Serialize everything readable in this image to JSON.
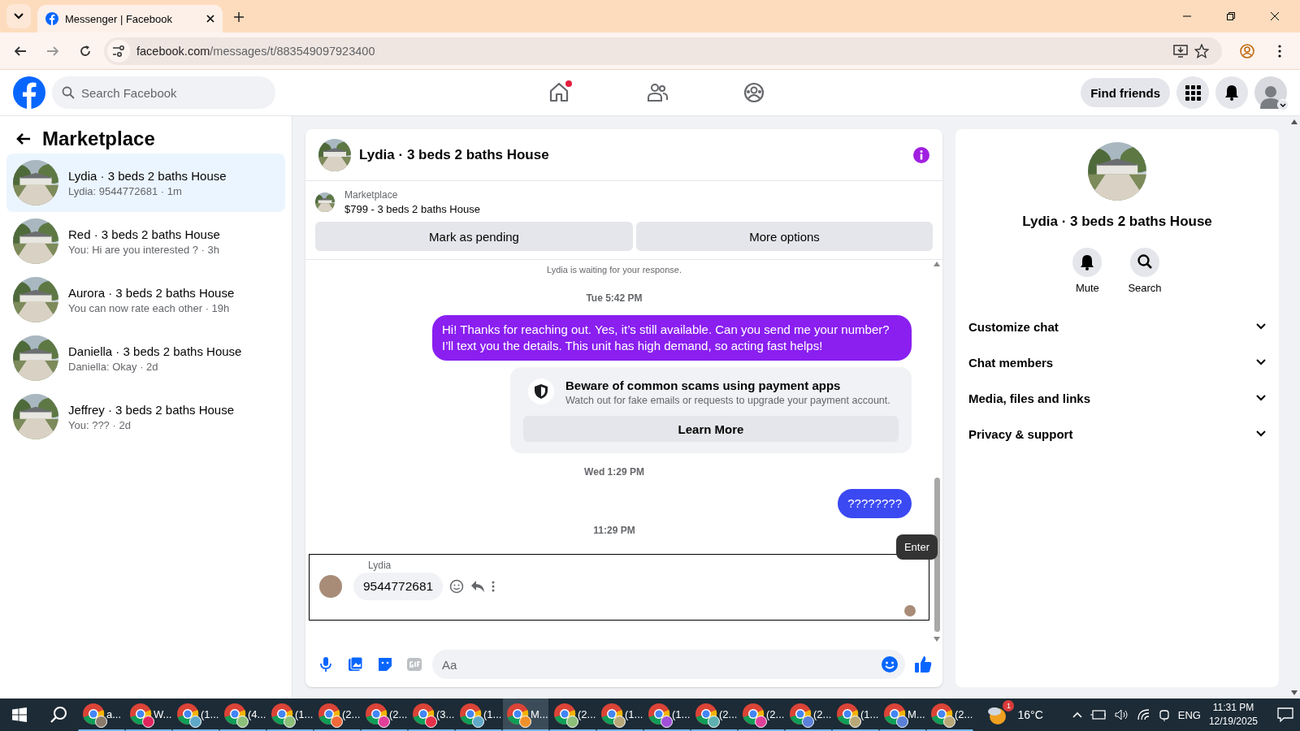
{
  "browser": {
    "tabs": [
      {
        "title": "Messenger | Facebook",
        "selected": true
      }
    ],
    "url_host": "facebook.com",
    "url_path": "/messages/t/883549097923400"
  },
  "header": {
    "search_placeholder": "Search Facebook",
    "nav": [
      {
        "kind": "home",
        "badge": true
      },
      {
        "kind": "friends",
        "badge": false
      },
      {
        "kind": "groups",
        "badge": false
      }
    ],
    "find_friends": "Find friends"
  },
  "sidebar": {
    "title": "Marketplace",
    "conversations": [
      {
        "name": "Lydia · 3 beds 2 baths House",
        "preview": "Lydia: 9544772681 · 1m",
        "selected": true
      },
      {
        "name": "Red · 3 beds 2 baths House",
        "preview": "You: Hi are you interested ? · 3h",
        "selected": false
      },
      {
        "name": "Aurora · 3 beds 2 baths House",
        "preview": "You can now rate each other · 19h",
        "selected": false
      },
      {
        "name": "Daniella · 3 beds 2 baths House",
        "preview": "Daniella: Okay · 2d",
        "selected": false
      },
      {
        "name": "Jeffrey · 3 beds 2 baths House",
        "preview": "You: ??? · 2d",
        "selected": false
      }
    ]
  },
  "chat": {
    "title": "Lydia · 3 beds 2 baths House",
    "listing": {
      "label": "Marketplace",
      "detail": "$799 - 3 beds 2 baths House"
    },
    "actions": [
      "Mark as pending",
      "More options"
    ],
    "messages": [
      {
        "kind": "notice",
        "text": "Lydia is waiting for your response."
      },
      {
        "kind": "timestamp",
        "text": "Tue 5:42 PM"
      },
      {
        "kind": "outgoing",
        "text": "Hi! Thanks for reaching out. Yes, it’s still available. Can you send me your number? I’ll text you the details. This unit has high demand, so acting fast helps!",
        "color": "#8a1ff0"
      },
      {
        "kind": "warning",
        "title": "Beware of common scams using payment apps",
        "text": "Watch out for fake emails or requests to upgrade your payment account.",
        "button": "Learn More"
      },
      {
        "kind": "timestamp",
        "text": "Wed 1:29 PM"
      },
      {
        "kind": "outgoing",
        "text": "????????",
        "color": "#3b49f2"
      },
      {
        "kind": "timestamp",
        "text": "11:29 PM"
      },
      {
        "kind": "incoming",
        "sender": "Lydia",
        "text": "9544772681"
      }
    ],
    "tooltip": "Enter",
    "composer_placeholder": "Aa"
  },
  "details": {
    "name": "Lydia · 3 beds 2 baths House",
    "actions": [
      {
        "kind": "mute",
        "label": "Mute"
      },
      {
        "kind": "search",
        "label": "Search"
      }
    ],
    "sections": [
      {
        "label": "Customize chat",
        "expanded": false
      },
      {
        "label": "Chat members",
        "expanded": false
      },
      {
        "label": "Media, files and links",
        "expanded": false
      },
      {
        "label": "Privacy & support",
        "expanded": false
      }
    ]
  },
  "taskbar": {
    "apps": [
      {
        "label": "a...",
        "selected": false,
        "color": "#8a7a6a"
      },
      {
        "label": "W...",
        "selected": false,
        "color": "#e0245e"
      },
      {
        "label": "(1...",
        "selected": false,
        "color": "#5fa8c8"
      },
      {
        "label": "(4...",
        "selected": false,
        "color": "#8cbf7a"
      },
      {
        "label": "(1...",
        "selected": false,
        "color": "#8cbf7a"
      },
      {
        "label": "(2...",
        "selected": false,
        "color": "#f06a3a"
      },
      {
        "label": "(2...",
        "selected": false,
        "color": "#e0409a"
      },
      {
        "label": "(3...",
        "selected": false,
        "color": "#e8304a"
      },
      {
        "label": "(1...",
        "selected": false,
        "color": "#5fa8c8"
      },
      {
        "label": "M...",
        "selected": true,
        "color": "#f0902a"
      },
      {
        "label": "(2...",
        "selected": false,
        "color": "#8cbf7a"
      },
      {
        "label": "(1...",
        "selected": false,
        "color": "#b8a878"
      },
      {
        "label": "(1...",
        "selected": false,
        "color": "#a050d8"
      },
      {
        "label": "(2...",
        "selected": false,
        "color": "#5fb0b0"
      },
      {
        "label": "(2...",
        "selected": false,
        "color": "#e0409a"
      },
      {
        "label": "(2...",
        "selected": false,
        "color": "#5a80d8"
      },
      {
        "label": "(1...",
        "selected": false,
        "color": "#b8a878"
      },
      {
        "label": "M...",
        "selected": false,
        "color": "#5a80d8"
      },
      {
        "label": "(2...",
        "selected": false,
        "color": "#b8a878"
      }
    ],
    "weather_badge": "1",
    "temperature": "16°C",
    "language": "ENG",
    "time": "11:31 PM",
    "date": "12/19/2025"
  }
}
